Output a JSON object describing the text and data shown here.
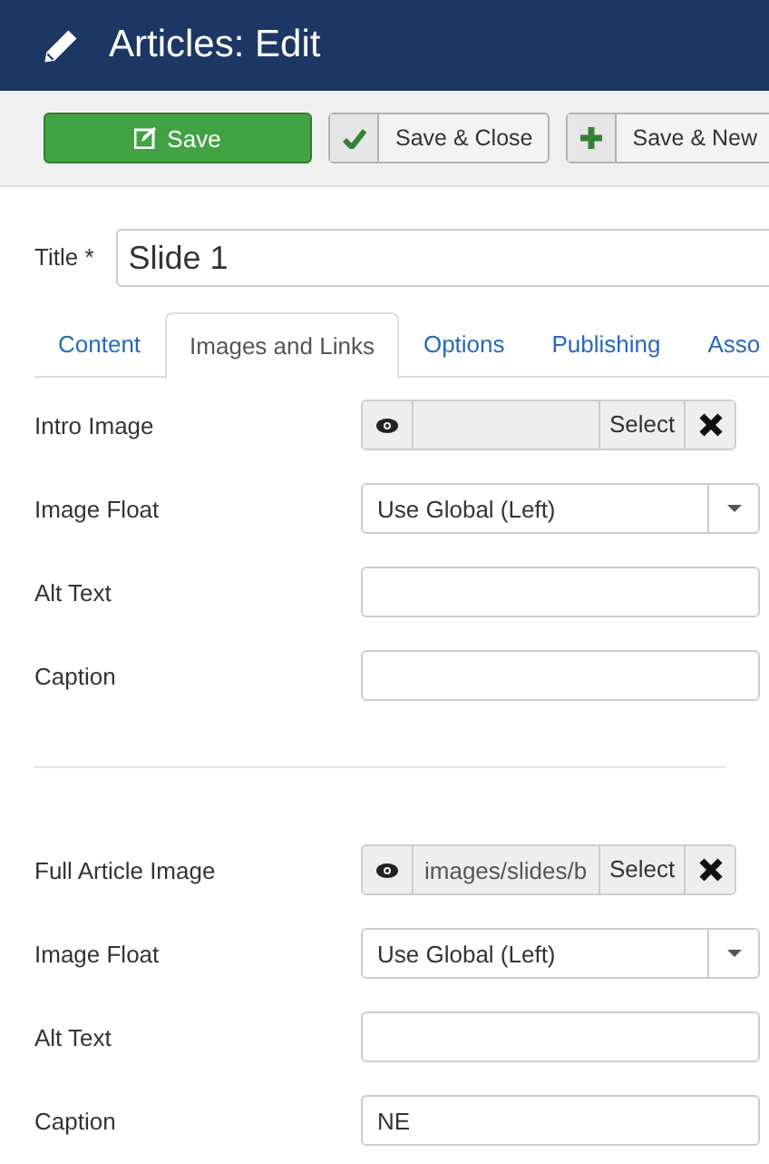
{
  "header": {
    "title": "Articles: Edit"
  },
  "toolbar": {
    "buttons": [
      {
        "label": "Save",
        "kind": "primary"
      },
      {
        "label": "Save & Close",
        "kind": "check"
      },
      {
        "label": "Save & New",
        "kind": "plus"
      }
    ]
  },
  "title_field": {
    "label": "Title *",
    "value": "Slide 1"
  },
  "tabs": [
    {
      "label": "Content",
      "selected": false
    },
    {
      "label": "Images and Links",
      "selected": true
    },
    {
      "label": "Options",
      "selected": false
    },
    {
      "label": "Publishing",
      "selected": false
    },
    {
      "label": "Asso",
      "selected": false
    }
  ],
  "sections": [
    {
      "fields": [
        {
          "kind": "media",
          "label": "Intro Image",
          "button": "Select"
        },
        {
          "kind": "select",
          "label": "Image Float",
          "value": "Use Global (Left)"
        },
        {
          "kind": "text",
          "label": "Alt Text"
        },
        {
          "kind": "text",
          "label": "Caption"
        }
      ]
    },
    {
      "fields": [
        {
          "kind": "media",
          "label": "Full Article Image",
          "value": "images/slides/b",
          "button": "Select"
        },
        {
          "kind": "select",
          "label": "Image Float",
          "value": "Use Global (Left)"
        },
        {
          "kind": "text",
          "label": "Alt Text"
        },
        {
          "kind": "text",
          "label": "Caption",
          "value": "NE"
        }
      ]
    }
  ]
}
